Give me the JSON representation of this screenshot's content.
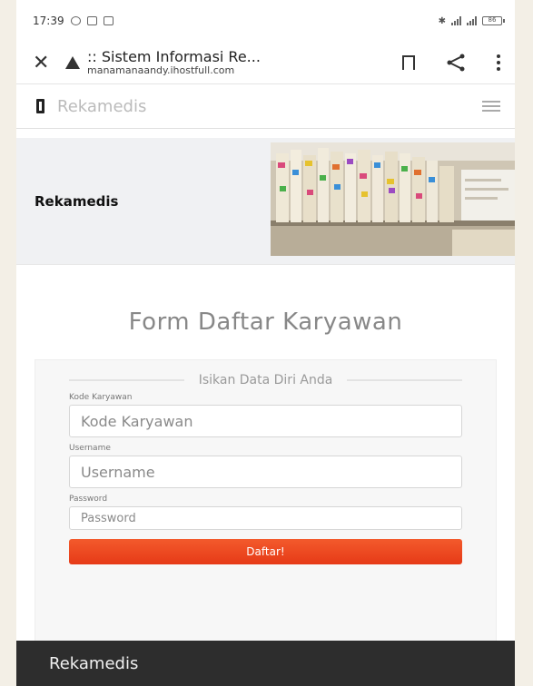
{
  "status_bar": {
    "time": "17:39",
    "battery": "86"
  },
  "browser": {
    "tab_title": ":: Sistem Informasi Re...",
    "url": "manamanaandy.ihostfull.com",
    "icons": [
      "close-icon",
      "warning-icon",
      "bookmark-icon",
      "share-icon",
      "more-vertical-icon"
    ]
  },
  "navbar": {
    "brand": "Rekamedis",
    "icons": [
      "brand-icon",
      "hamburger-icon"
    ]
  },
  "hero": {
    "title": "Rekamedis"
  },
  "form": {
    "heading": "Form Daftar Karyawan",
    "card_heading": "Isikan Data Diri Anda",
    "fields": [
      {
        "label": "Kode Karyawan",
        "placeholder": "Kode Karyawan",
        "value": ""
      },
      {
        "label": "Username",
        "placeholder": "Username",
        "value": ""
      },
      {
        "label": "Password",
        "placeholder": "Password",
        "value": ""
      }
    ],
    "submit_label": "Daftar!",
    "accent_color": "#eb4a20"
  },
  "footer": {
    "title": "Rekamedis",
    "background": "#2d2d2d"
  }
}
